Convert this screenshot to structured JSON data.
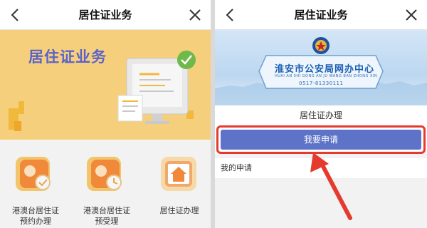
{
  "left_screen": {
    "title": "居住证业务",
    "banner_title": "居住证业务",
    "services": [
      {
        "label_line1": "港澳台居住证",
        "label_line2": "预约办理",
        "icon": "hongkong-calendar-check-icon"
      },
      {
        "label_line1": "港澳台居住证",
        "label_line2": "预受理",
        "icon": "hongkong-clock-icon"
      },
      {
        "label_line1": "居住证办理",
        "label_line2": "",
        "icon": "house-icon"
      }
    ]
  },
  "right_screen": {
    "title": "居住证业务",
    "banner": {
      "name": "淮安市公安局网办中心",
      "pinyin": "HUAI AN SHI GONG AN JU WANG BAN ZHONG XIN",
      "phone": "0517-81330111"
    },
    "section_title": "居住证办理",
    "apply_button": "我要申请",
    "my_application": "我的申请"
  },
  "colors": {
    "banner_yellow": "#f6cf7d",
    "title_purple": "#5a63c9",
    "button_blue": "#5d73c8",
    "highlight_red": "#e53b2f"
  }
}
